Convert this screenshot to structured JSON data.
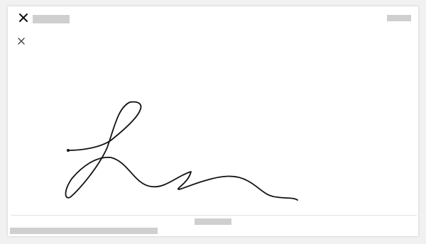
{
  "header": {
    "close_icon": "close-icon",
    "title_placeholder": "",
    "action_placeholder": ""
  },
  "pad": {
    "clear_icon": "close-icon",
    "stroke_color": "#111111",
    "background_color": "#ffffff"
  },
  "footer": {
    "center_placeholder": "",
    "left_placeholder": ""
  }
}
